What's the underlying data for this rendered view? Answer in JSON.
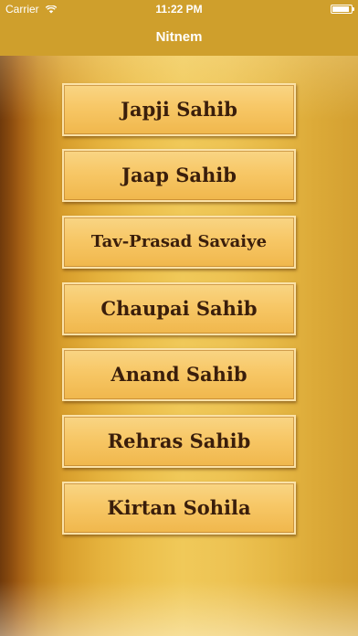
{
  "status_bar": {
    "carrier": "Carrier",
    "time": "11:22 PM",
    "wifi_icon": "wifi-icon",
    "battery_icon": "battery-icon",
    "battery_level": 0.9
  },
  "nav": {
    "title": "Nitnem"
  },
  "menu": {
    "items": [
      {
        "label": "Japji Sahib"
      },
      {
        "label": "Jaap Sahib"
      },
      {
        "label": "Tav-Prasad Savaiye"
      },
      {
        "label": "Chaupai Sahib"
      },
      {
        "label": "Anand Sahib"
      },
      {
        "label": "Rehras  Sahib"
      },
      {
        "label": "Kirtan Sohila"
      }
    ]
  }
}
